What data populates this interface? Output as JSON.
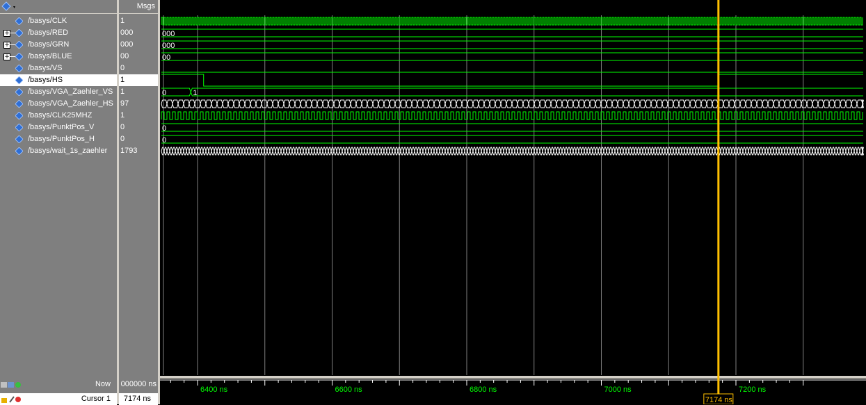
{
  "header": {
    "msgs_label": "Msgs"
  },
  "signals": [
    {
      "name": "/basys/CLK",
      "value": "1",
      "expandable": false,
      "wave": "clock_fast"
    },
    {
      "name": "/basys/RED",
      "value": "000",
      "expandable": true,
      "wave": "bus_const",
      "bus_label": "000"
    },
    {
      "name": "/basys/GRN",
      "value": "000",
      "expandable": true,
      "wave": "bus_const",
      "bus_label": "000"
    },
    {
      "name": "/basys/BLUE",
      "value": "00",
      "expandable": true,
      "wave": "bus_const",
      "bus_label": "00"
    },
    {
      "name": "/basys/VS",
      "value": "0",
      "expandable": false,
      "wave": "low"
    },
    {
      "name": "/basys/HS",
      "value": "1",
      "expandable": false,
      "wave": "hs",
      "selected": true
    },
    {
      "name": "/basys/VGA_Zaehler_VS",
      "value": "1",
      "expandable": false,
      "wave": "bus_change",
      "bus_labels": [
        "0",
        "1"
      ]
    },
    {
      "name": "/basys/VGA_Zaehler_HS",
      "value": "97",
      "expandable": false,
      "wave": "bus_counting"
    },
    {
      "name": "/basys/CLK25MHZ",
      "value": "1",
      "expandable": false,
      "wave": "clock_slow"
    },
    {
      "name": "/basys/PunktPos_V",
      "value": "0",
      "expandable": false,
      "wave": "bus_const",
      "bus_label": "0"
    },
    {
      "name": "/basys/PunktPos_H",
      "value": "0",
      "expandable": false,
      "wave": "bus_const",
      "bus_label": "0"
    },
    {
      "name": "/basys/wait_1s_zaehler",
      "value": "1793",
      "expandable": false,
      "wave": "bus_counting_fast"
    }
  ],
  "footer": {
    "now_label": "Now",
    "now_value": "000000 ns",
    "cursor_label": "Cursor 1",
    "cursor_value": "7174 ns",
    "cursor_flag": "7174 ns"
  },
  "timeline": {
    "ticks": [
      "6400 ns",
      "6600 ns",
      "6800 ns",
      "7000 ns",
      "7200 ns"
    ],
    "tick_values": [
      6400,
      6600,
      6800,
      7000,
      7200
    ],
    "cursor_time": 7174
  },
  "colors": {
    "wave": "#00ff00",
    "cursor": "#ffbf00",
    "grid": "#808080",
    "diamond": "#2f6fd6"
  }
}
